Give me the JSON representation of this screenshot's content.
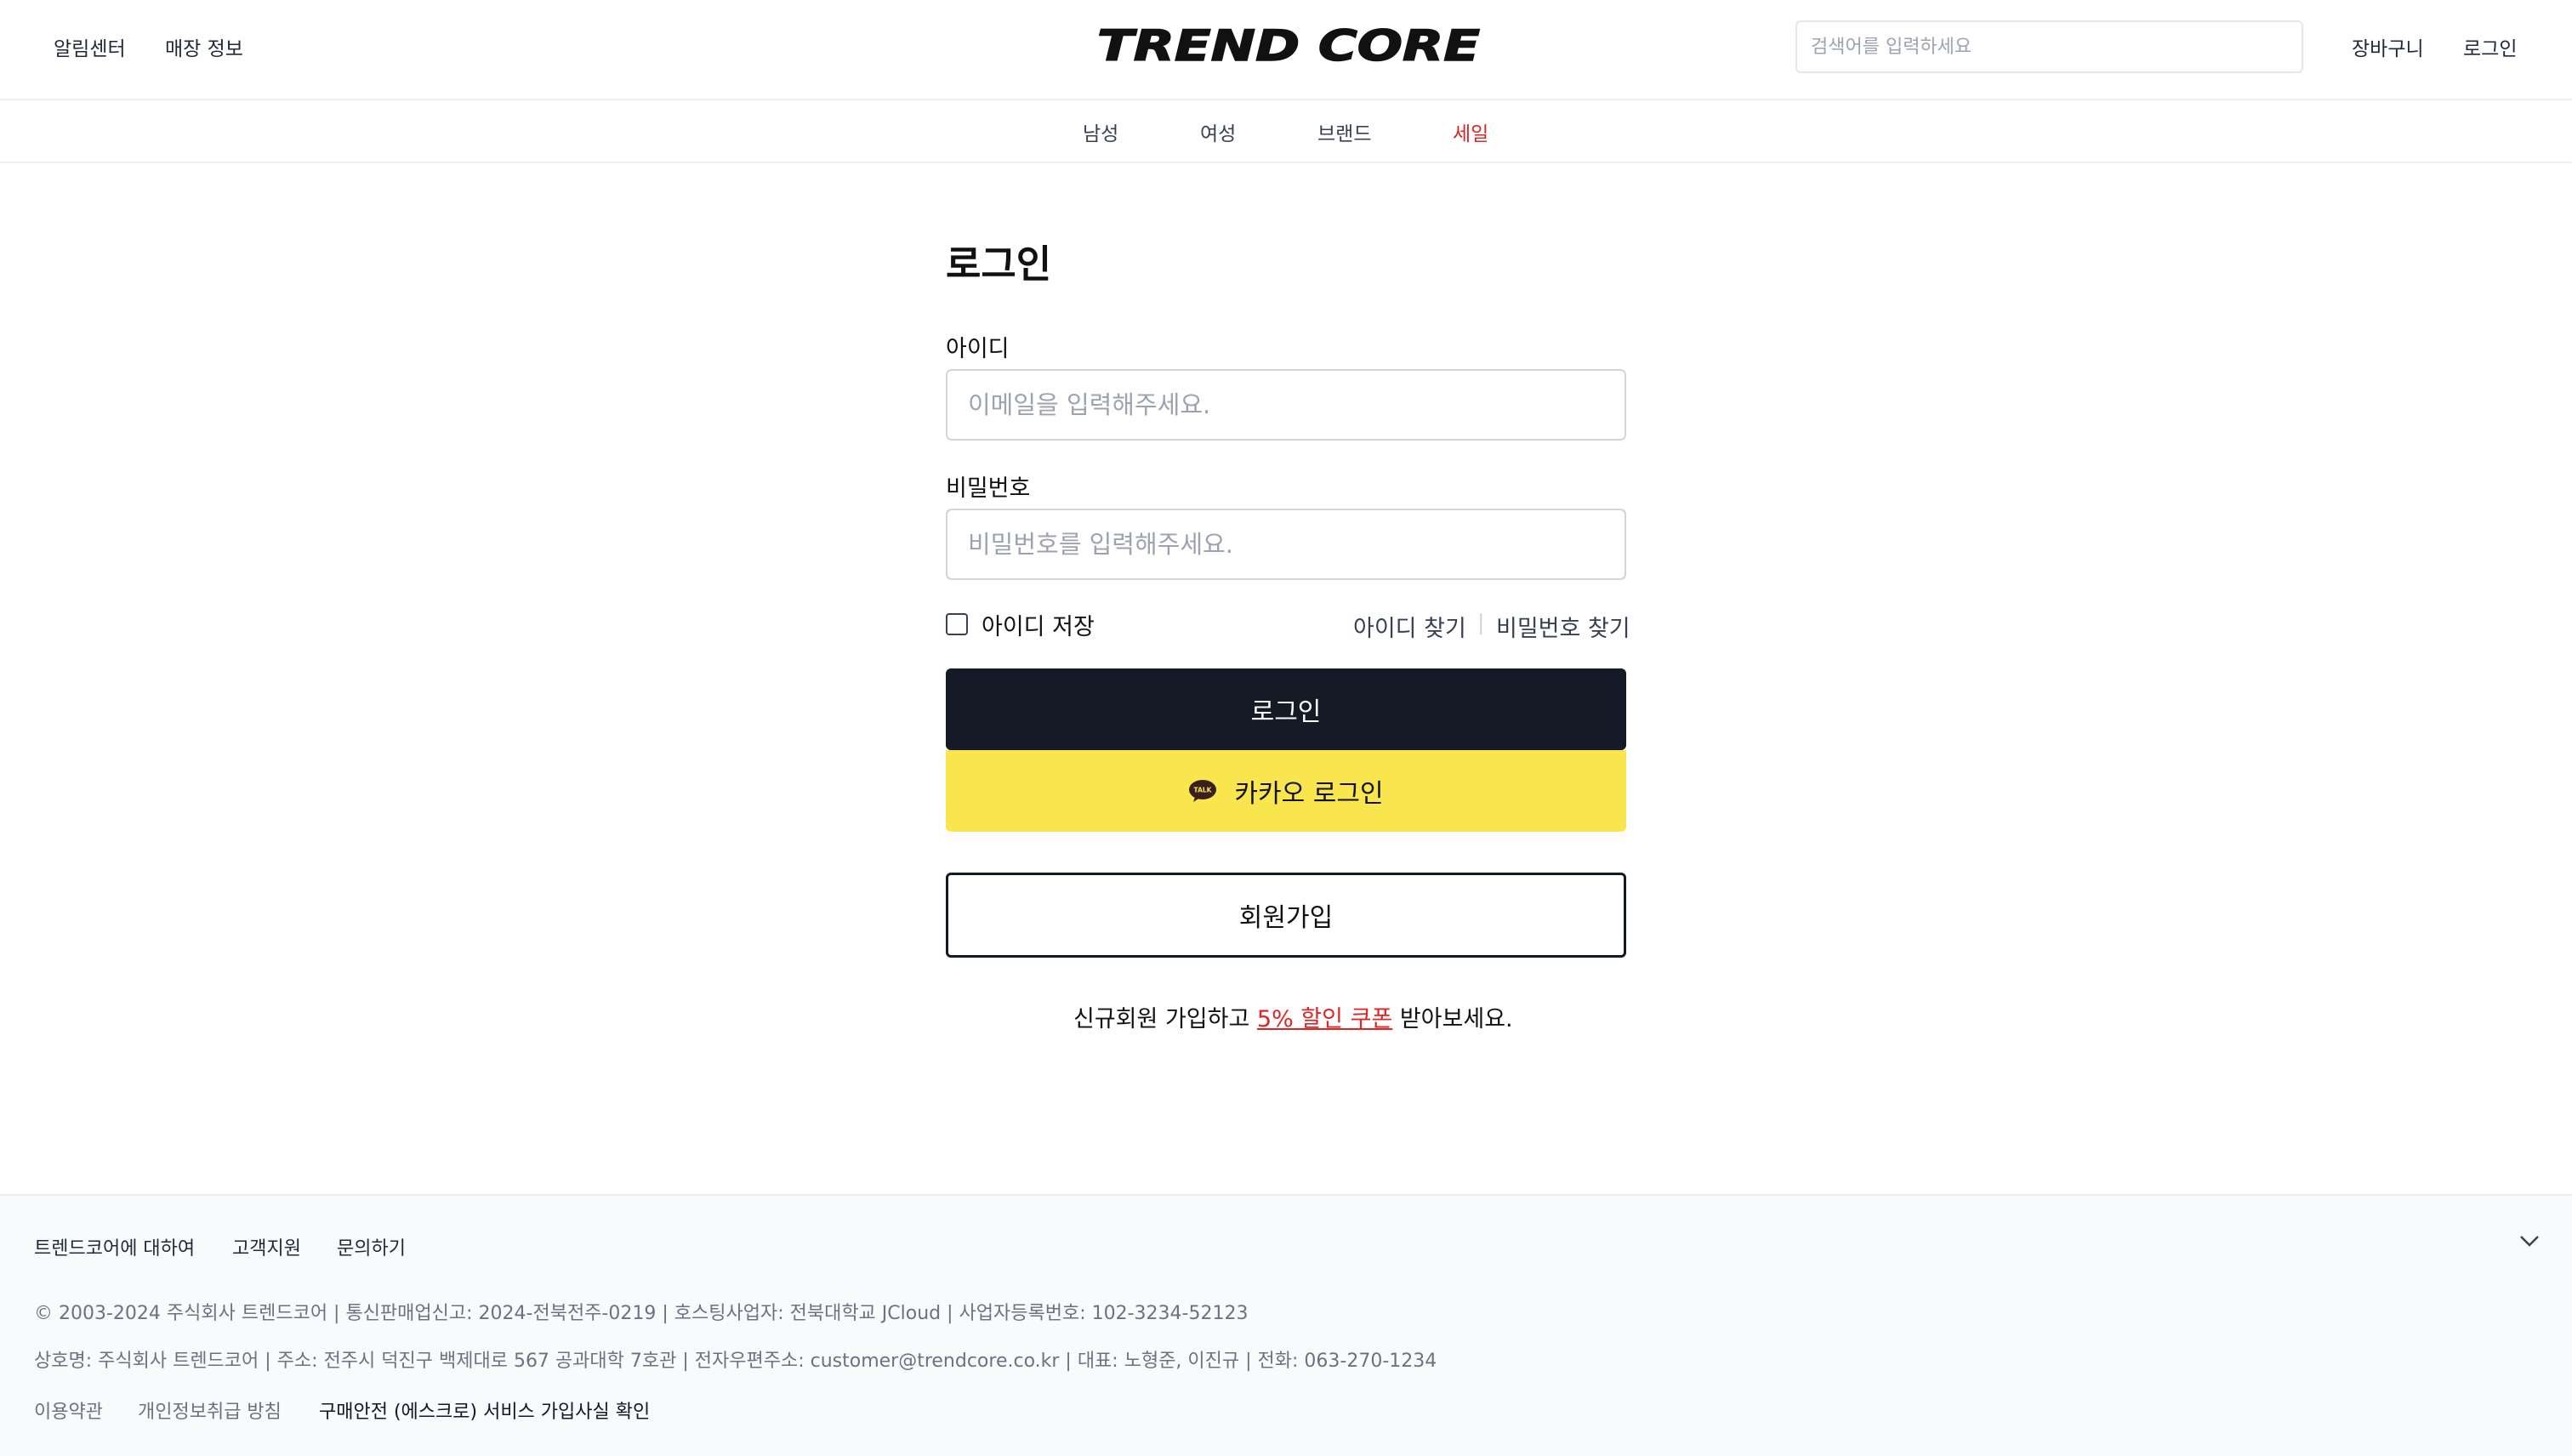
{
  "header": {
    "links_left": [
      "알림센터",
      "매장 정보"
    ],
    "logo_text": "TREND CORE",
    "search_placeholder": "검색어를 입력하세요",
    "links_right": [
      "장바구니",
      "로그인"
    ]
  },
  "nav": {
    "items": [
      "남성",
      "여성",
      "브랜드",
      "세일"
    ]
  },
  "login": {
    "title": "로그인",
    "id_label": "아이디",
    "id_placeholder": "이메일을 입력해주세요.",
    "id_value": "",
    "password_label": "비밀번호",
    "password_placeholder": "비밀번호를 입력해주세요.",
    "password_value": "",
    "remember_label": "아이디 저장",
    "remember_checked": false,
    "find_id": "아이디 찾기",
    "separator": "|",
    "find_password": "비밀번호 찾기",
    "login_button": "로그인",
    "kakao_button": "카카오 로그인",
    "kakao_icon_text": "TALK",
    "signup_button": "회원가입",
    "promo_prefix": "신규회원 가입하고 ",
    "promo_link": "5% 할인 쿠폰",
    "promo_suffix": " 받아보세요."
  },
  "footer": {
    "links": [
      "트렌드코어에 대하여",
      "고객지원",
      "문의하기"
    ],
    "line1": "© 2003-2024 주식회사 트렌드코어 | 통신판매업신고: 2024-전북전주-0219 | 호스팅사업자: 전북대학교 JCloud | 사업자등록번호: 102-3234-52123",
    "line2": "상호명: 주식회사 트렌드코어 | 주소: 전주시 덕진구 백제대로 567 공과대학 7호관 | 전자우편주소: customer@trendcore.co.kr | 대표: 노형준, 이진규 | 전화: 063-270-1234",
    "bottom_links": [
      "이용약관",
      "개인정보취급 방침",
      "구매안전 (에스크로) 서비스 가입사실 확인"
    ]
  },
  "colors": {
    "primary_dark": "#141a26",
    "kakao_yellow": "#f9e54d",
    "sale_red": "#dc2626"
  },
  "icons": [
    "kakao-talk-icon",
    "chevron-down-icon"
  ]
}
